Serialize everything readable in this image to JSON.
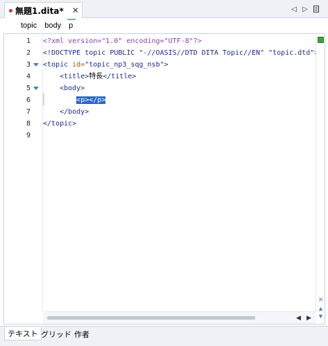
{
  "tab": {
    "title": "無題1.dita*",
    "close": "✕"
  },
  "tab_nav": {
    "prev": "◁",
    "next": "▷"
  },
  "breadcrumb": [
    "topic",
    "body",
    "p"
  ],
  "editor": {
    "line_numbers": [
      "1",
      "2",
      "3",
      "4",
      "5",
      "6",
      "7",
      "8",
      "9"
    ],
    "lines": [
      [
        {
          "t": "<?xml version=\"1.0\" encoding=\"UTF-8\"?>",
          "c": "pi"
        }
      ],
      [
        {
          "t": "<!DOCTYPE topic PUBLIC \"-//OASIS//DTD DITA Topic//EN\" \"topic.dtd\">",
          "c": "doctype"
        }
      ],
      [
        {
          "t": "<topic ",
          "c": "tag"
        },
        {
          "t": "id=",
          "c": "attr"
        },
        {
          "t": "\"topic_np3_sqg_nsb\"",
          "c": "val"
        },
        {
          "t": ">",
          "c": "tag"
        }
      ],
      [
        {
          "t": "    <title>",
          "c": "tag"
        },
        {
          "t": "特長",
          "c": "txt"
        },
        {
          "t": "</title>",
          "c": "tag"
        }
      ],
      [
        {
          "t": "    <body>",
          "c": "tag"
        }
      ],
      [
        {
          "t": "        ",
          "c": "txt"
        },
        {
          "t": "<p></p>",
          "c": "sel"
        }
      ],
      [
        {
          "t": "    </body>",
          "c": "tag"
        }
      ],
      [
        {
          "t": "</topic>",
          "c": "tag"
        }
      ],
      []
    ]
  },
  "scroll": {
    "left": "◀",
    "right": "▶",
    "up": "▲",
    "down": "▼",
    "close": "✕"
  },
  "modes": [
    "テキスト",
    "グリッド",
    "作者"
  ]
}
